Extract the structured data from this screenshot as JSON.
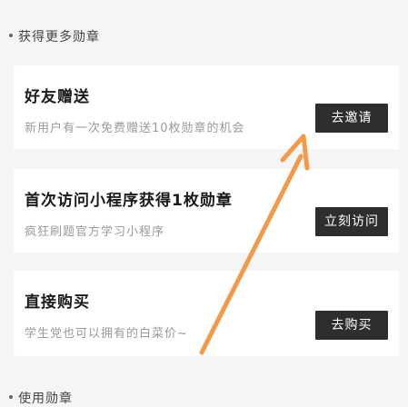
{
  "sections": {
    "earn_title": "获得更多勋章",
    "use_title": "使用勋章"
  },
  "cards": [
    {
      "title": "好友赠送",
      "desc": "新用户有一次免费赠送10枚勋章的机会",
      "button": "去邀请"
    },
    {
      "title": "首次访问小程序获得1枚勋章",
      "desc": "疯狂刷题官方学习小程序",
      "button": "立刻访问"
    },
    {
      "title": "直接购买",
      "desc": "学生党也可以拥有的白菜价~",
      "button": "去购买"
    }
  ],
  "colors": {
    "background": "#f5f5f5",
    "card": "#ffffff",
    "button": "#2e2e2e",
    "arrow": "#f39a4a"
  },
  "icons": {
    "annotation": "orange-arrow-icon"
  }
}
